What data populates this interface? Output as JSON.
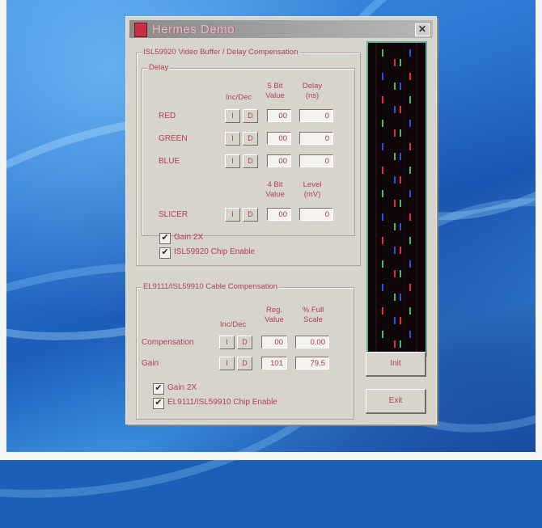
{
  "window": {
    "title": "Hermes Demo",
    "close_glyph": "✕"
  },
  "video_group": {
    "title": "ISL59920 Video Buffer / Delay Compensation",
    "delay_group": {
      "title": "Delay",
      "col_incdec": "Inc/Dec",
      "col_value": "5 Bit Value",
      "col_delay": "Delay (ns)",
      "rows": [
        {
          "label": "RED",
          "inc": "I",
          "dec": "D",
          "value": "00",
          "delay": "0"
        },
        {
          "label": "GREEN",
          "inc": "I",
          "dec": "D",
          "value": "00",
          "delay": "0"
        },
        {
          "label": "BLUE",
          "inc": "I",
          "dec": "D",
          "value": "00",
          "delay": "0"
        }
      ],
      "col_value2": "4 Bit Value",
      "col_level": "Level (mV)",
      "slicer": {
        "label": "SLICER",
        "inc": "I",
        "dec": "D",
        "value": "00",
        "level": "0"
      }
    },
    "gain_check": {
      "label": "Gain 2X",
      "checked": true
    },
    "chip_check": {
      "label": "ISL59920 Chip Enable",
      "checked": true
    }
  },
  "cable_group": {
    "title": "EL9111/ISL59910 Cable Compensation",
    "col_incdec": "Inc/Dec",
    "col_reg": "Reg. Value",
    "col_full": "% Full Scale",
    "rows": [
      {
        "label": "Compensation",
        "inc": "I",
        "dec": "D",
        "value": "00",
        "full": "0.00"
      },
      {
        "label": "Gain",
        "inc": "I",
        "dec": "D",
        "value": "101",
        "full": "79.5"
      }
    ],
    "gain_check": {
      "label": "Gain 2X",
      "checked": true
    },
    "chip_check": {
      "label": "EL9111/ISL59910 Chip Enable",
      "checked": true
    }
  },
  "buttons": {
    "init": "Init",
    "exit": "Exit"
  },
  "scope": {
    "trace_colors": [
      "#e0303c",
      "#40c060",
      "#3050e0",
      "#e0e0e0"
    ]
  }
}
